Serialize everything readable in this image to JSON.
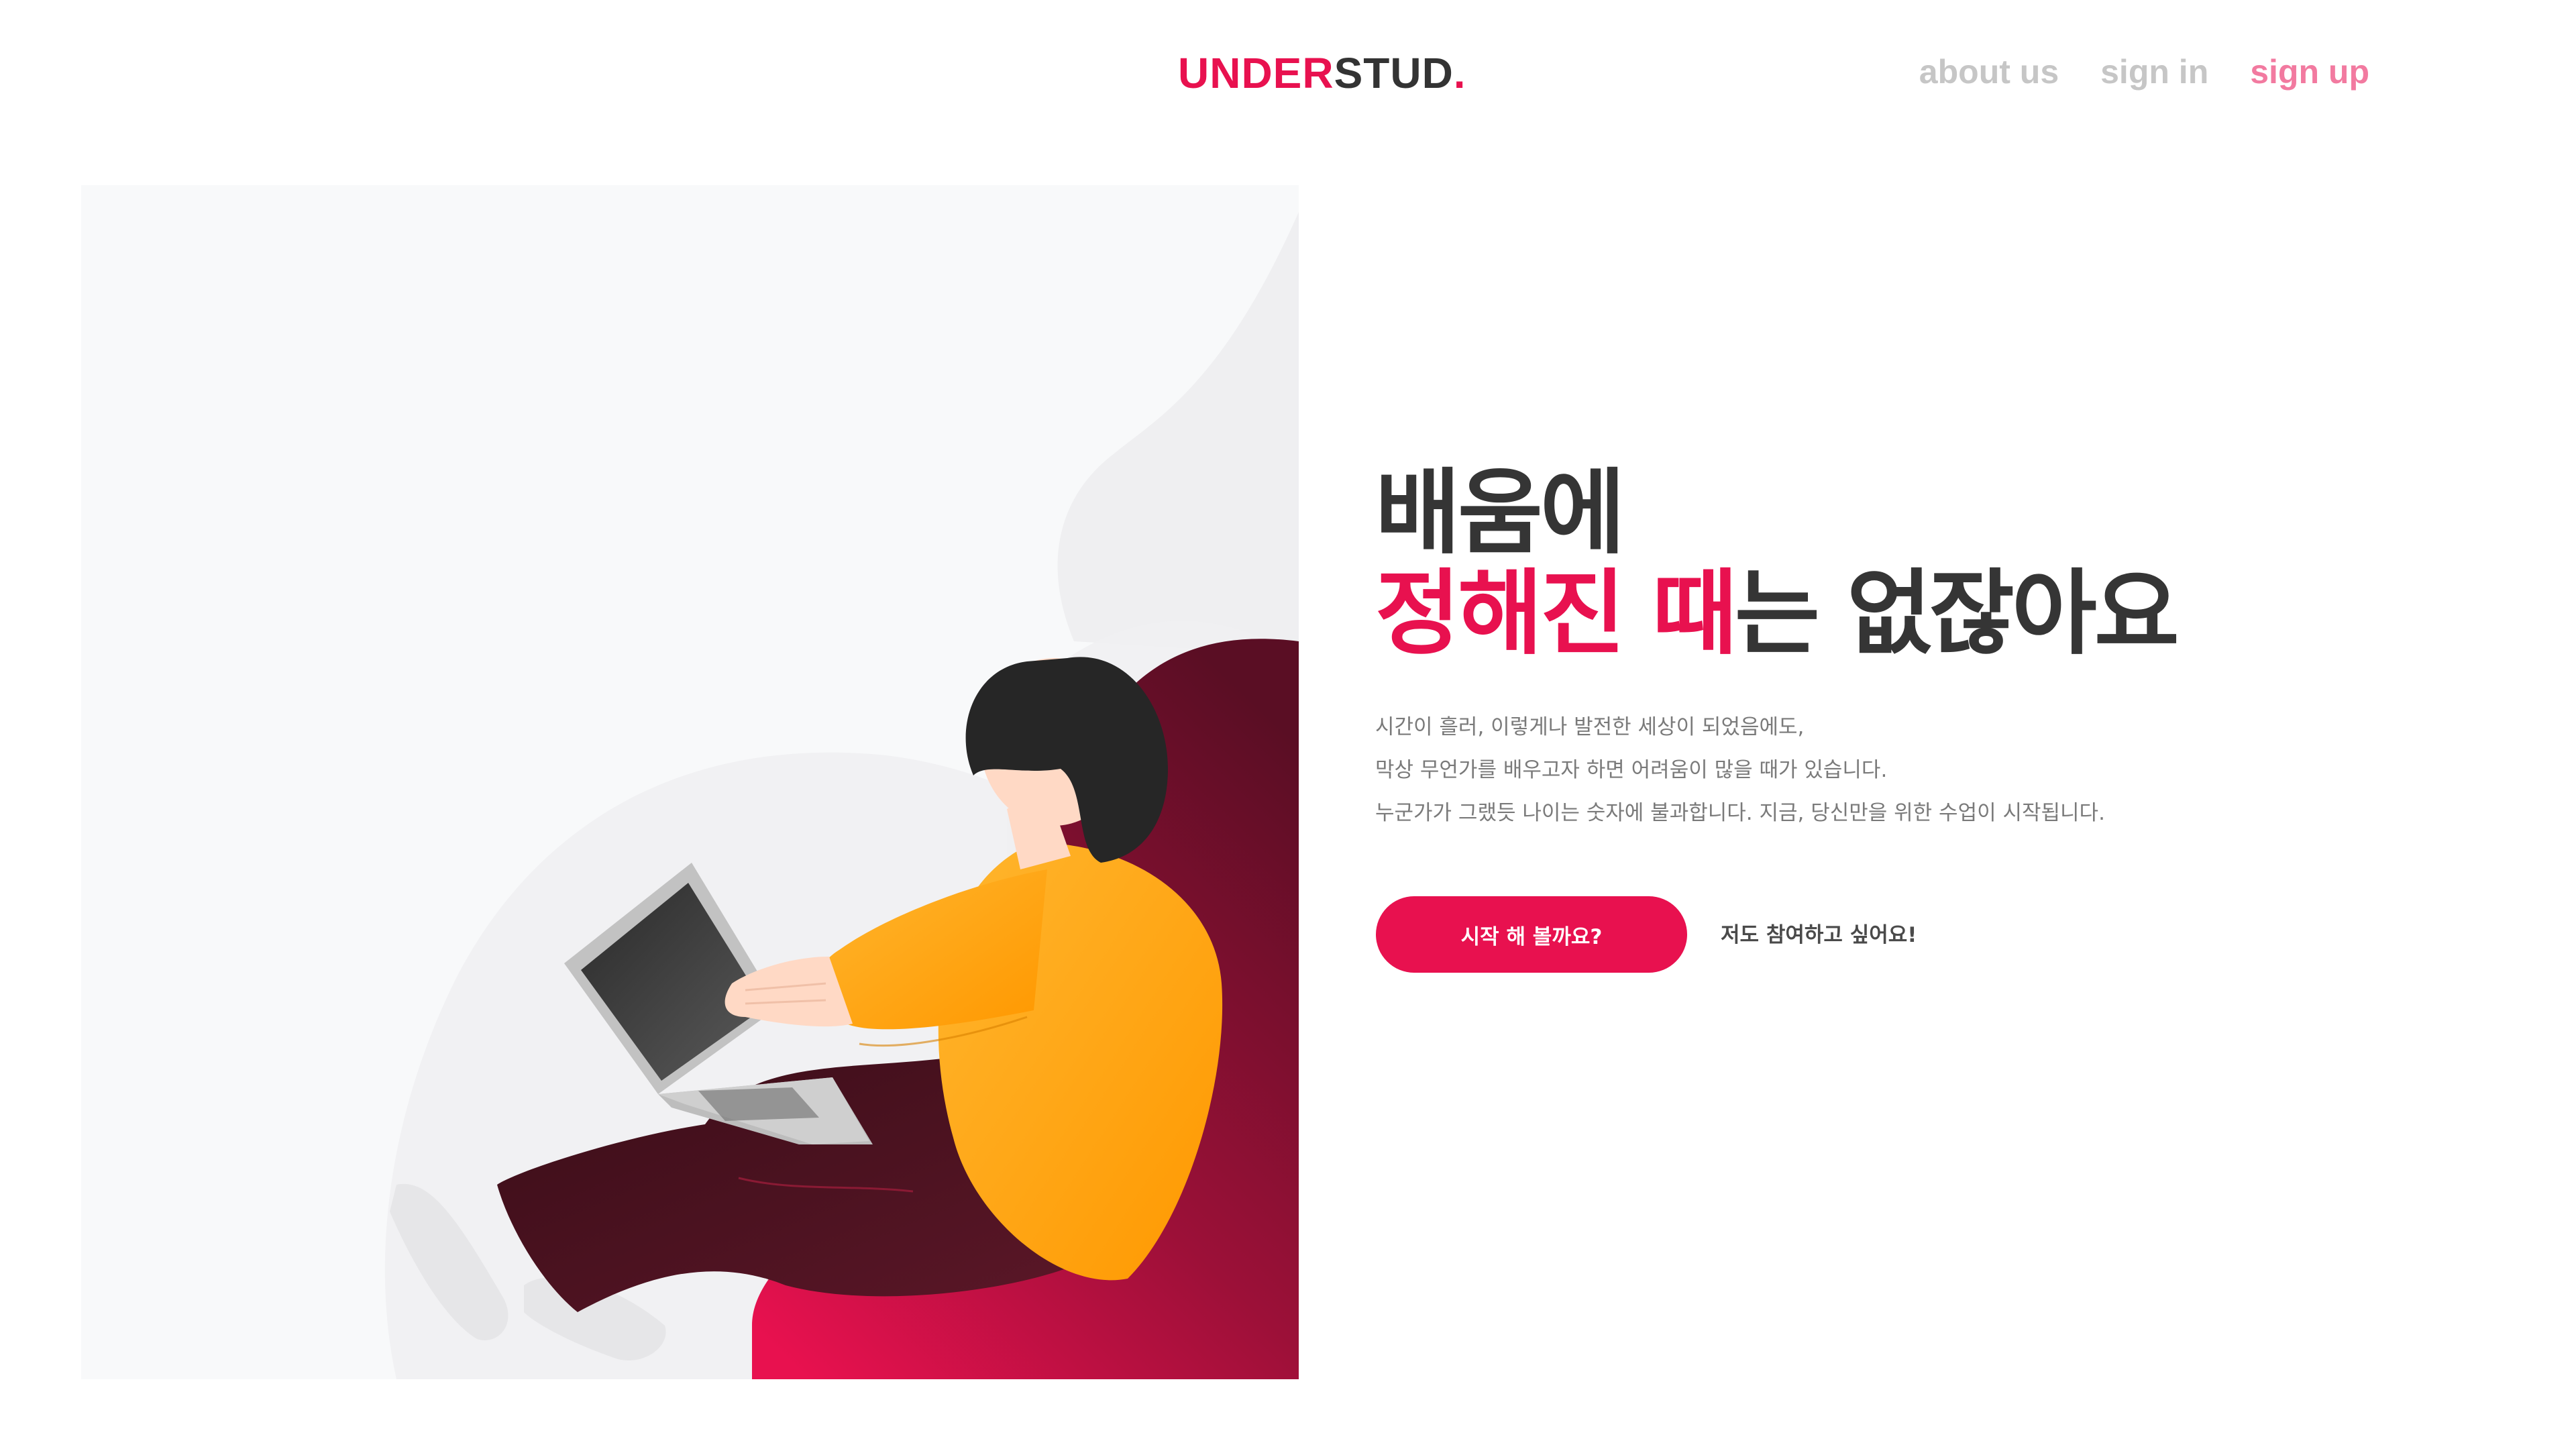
{
  "header": {
    "logo_main": "UNDER",
    "logo_rest": "STUD",
    "logo_dot": ".",
    "nav": {
      "about_label": "about us",
      "signin_label": "sign in",
      "signup_label": "sign up"
    }
  },
  "hero": {
    "headline_line1": "배움에",
    "headline_highlight_1": "정해진",
    "headline_highlight_2": "때",
    "headline_rest": "는 없잖아요",
    "description": [
      "시간이 흘러, 이렇게나 발전한 세상이 되었음에도,",
      "막상 무언가를 배우고자 하면 어려움이 많을 때가 있습니다.",
      "누군가가 그랬듯 나이는 숫자에 불과합니다. 지금, 당신만을 위한 수업이 시작됩니다."
    ],
    "cta_primary_label": "시작 해 볼까요?",
    "cta_secondary_label": "저도 참여하고 싶어요!"
  },
  "colors": {
    "accent": "#e8114f",
    "accent_light": "#f27aa0",
    "text_dark": "#353535",
    "text_muted": "#7a7a7a",
    "nav_muted": "#c6c6c6"
  },
  "illustration": {
    "icon": "person-with-laptop-illustration"
  }
}
